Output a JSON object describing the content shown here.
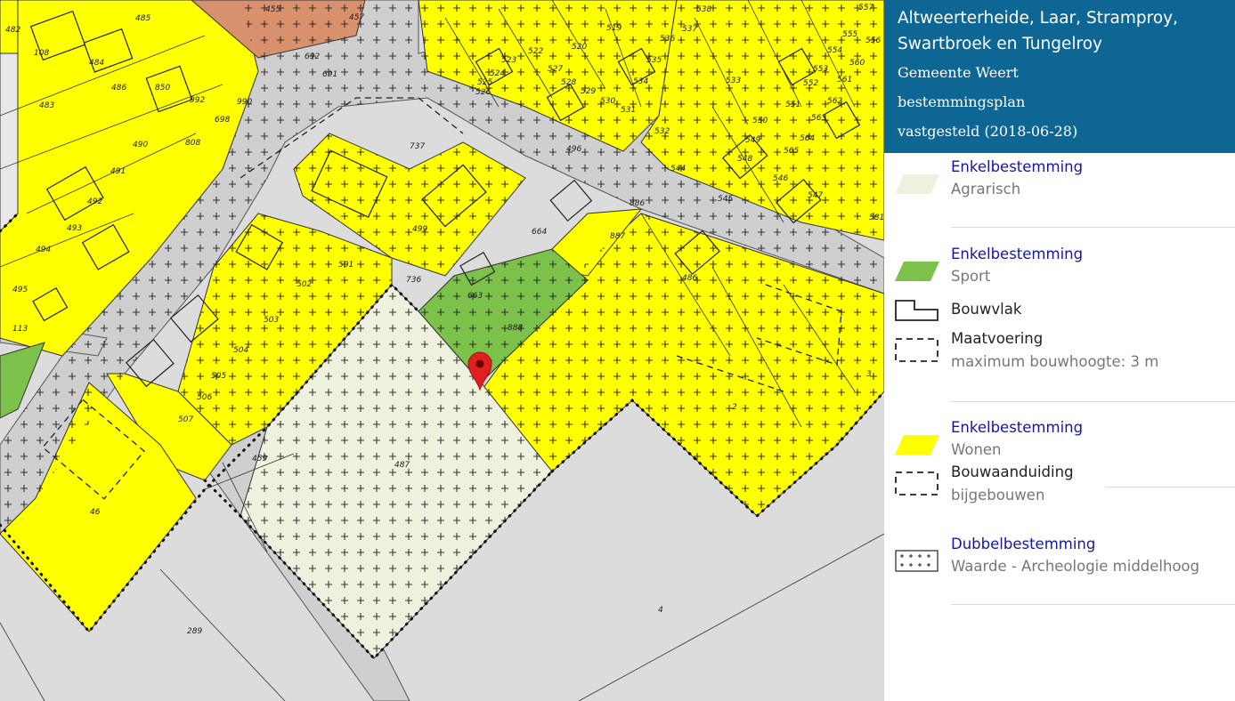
{
  "header": {
    "title": "Altweerterheide, Laar, Stramproy, Swartbroek en Tungelroy",
    "municipality": "Gemeente Weert",
    "plan_type": "bestemmingsplan",
    "status": "vastgesteld (2018-06-28)"
  },
  "legend": {
    "agrarisch": {
      "category": "Enkelbestemming",
      "name": "Agrarisch",
      "color": "#eef1dd"
    },
    "sport": {
      "category": "Enkelbestemming",
      "name": "Sport",
      "color": "#7cc24a"
    },
    "bouwvlak": {
      "name": "Bouwvlak"
    },
    "maatvoering": {
      "name": "Maatvoering",
      "detail": "maximum bouwhoogte: 3 m"
    },
    "wonen": {
      "category": "Enkelbestemming",
      "name": "Wonen",
      "color": "#ffff00"
    },
    "bouwaanduiding": {
      "name": "Bouwaanduiding",
      "detail": "bijgebouwen"
    },
    "archeologie": {
      "category": "Dubbelbestemming",
      "name": "Waarde - Archeologie middelhoog"
    }
  },
  "map": {
    "colors": {
      "road": "#cfcfcf",
      "background": "#dcdcdc",
      "commercial": "#d9906c",
      "marker": "#e02020"
    },
    "plot_numbers": [
      "455",
      "457",
      "485",
      "482",
      "108",
      "484",
      "486",
      "483",
      "850",
      "992",
      "990",
      "698",
      "808",
      "490",
      "491",
      "492",
      "493",
      "494",
      "495",
      "113",
      "691",
      "692",
      "737",
      "499",
      "501",
      "502",
      "503",
      "504",
      "505",
      "506",
      "507",
      "46",
      "459",
      "289",
      "487",
      "736",
      "663",
      "664",
      "888",
      "887",
      "886",
      "486",
      "496",
      "519",
      "520",
      "523",
      "522",
      "524",
      "525",
      "526",
      "527",
      "528",
      "529",
      "530",
      "531",
      "532",
      "534",
      "535",
      "536",
      "537",
      "538",
      "533",
      "544",
      "545",
      "546",
      "547",
      "548",
      "549",
      "550",
      "551",
      "552",
      "553",
      "554",
      "555",
      "556",
      "557",
      "560",
      "561",
      "562",
      "563",
      "564",
      "565",
      "581",
      "2",
      "3",
      "4"
    ]
  }
}
